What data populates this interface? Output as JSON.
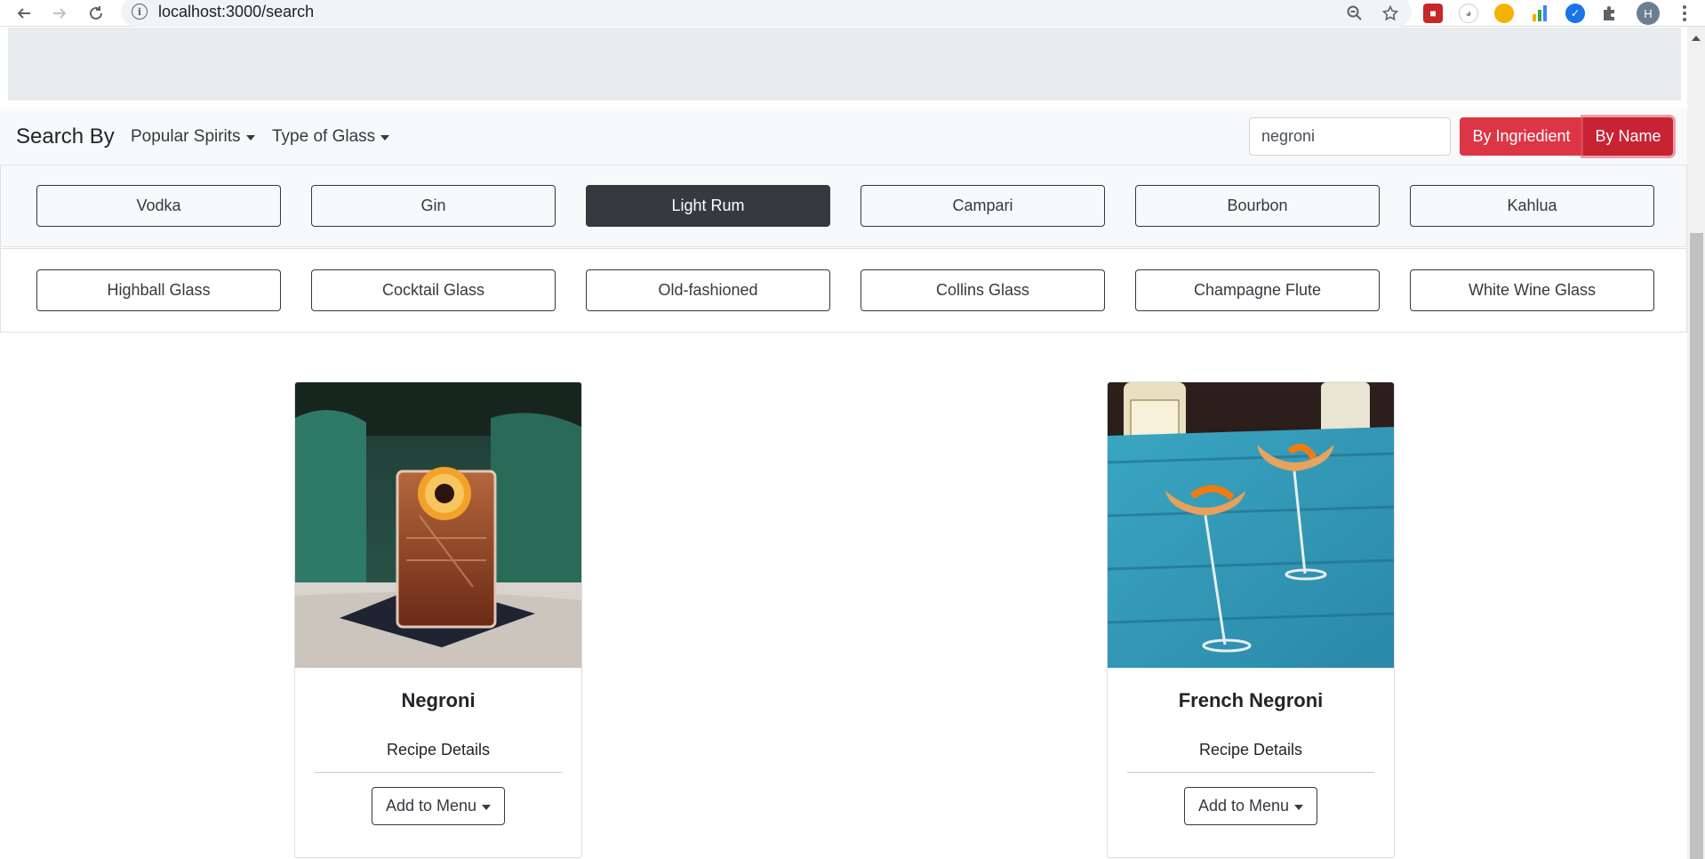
{
  "browser": {
    "url": "localhost:3000/search",
    "avatar_initial": "H",
    "icons": [
      "back-icon",
      "forward-icon",
      "reload-icon",
      "site-info-icon",
      "zoom-icon",
      "bookmark-star-icon",
      "extensions-puzzle-icon",
      "menu-icon"
    ]
  },
  "navbar": {
    "brand": "Search By",
    "dropdown_spirits": "Popular Spirits",
    "dropdown_glass": "Type of Glass",
    "search_value": "negroni",
    "btn_ingredient": "By Ingriedient",
    "btn_name": "By Name"
  },
  "spirits": [
    {
      "label": "Vodka",
      "active": false
    },
    {
      "label": "Gin",
      "active": false
    },
    {
      "label": "Light Rum",
      "active": true
    },
    {
      "label": "Campari",
      "active": false
    },
    {
      "label": "Bourbon",
      "active": false
    },
    {
      "label": "Kahlua",
      "active": false
    }
  ],
  "glasses": [
    {
      "label": "Highball Glass"
    },
    {
      "label": "Cocktail Glass"
    },
    {
      "label": "Old-fashioned"
    },
    {
      "label": "Collins Glass"
    },
    {
      "label": "Champagne Flute"
    },
    {
      "label": "White Wine Glass"
    }
  ],
  "cards": [
    {
      "title": "Negroni",
      "link": "Recipe Details",
      "button": "Add to Menu"
    },
    {
      "title": "French Negroni",
      "link": "Recipe Details",
      "button": "Add to Menu"
    }
  ],
  "colors": {
    "accent_red": "#dc3545",
    "dark": "#343a40",
    "jumbotron": "#e9ecef",
    "navbar_bg": "#f8f9fa"
  }
}
